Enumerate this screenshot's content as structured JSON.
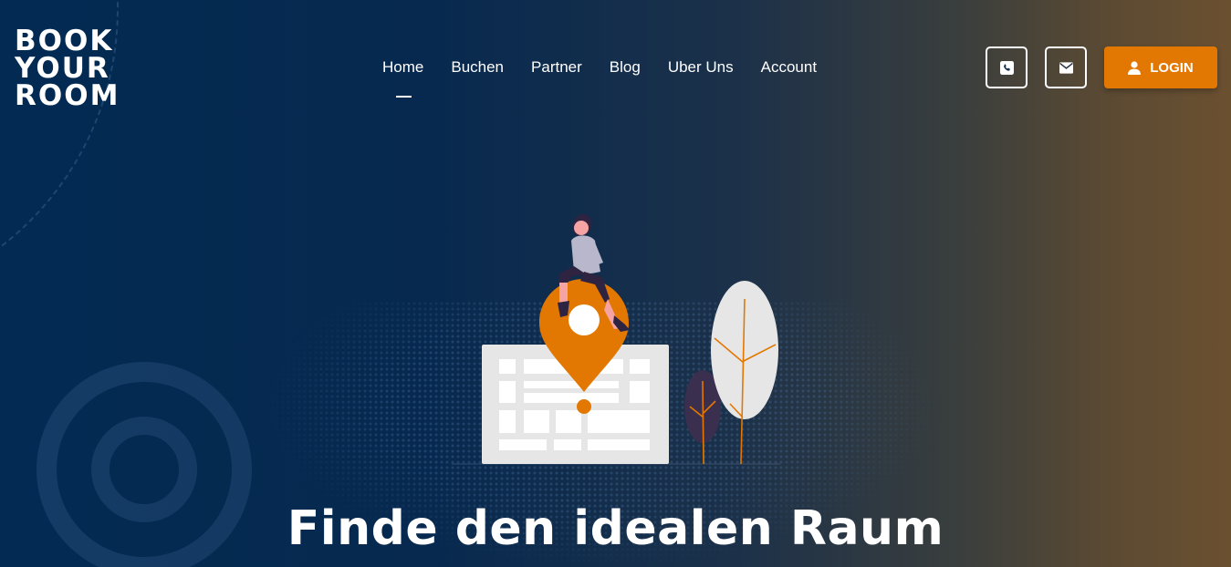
{
  "logo": {
    "line1": "BOOK",
    "line2": "YOUR",
    "line3": "ROOM"
  },
  "nav": {
    "items": [
      {
        "label": "Home",
        "active": true
      },
      {
        "label": "Buchen"
      },
      {
        "label": "Partner"
      },
      {
        "label": "Blog"
      },
      {
        "label": "Uber Uns"
      },
      {
        "label": "Account"
      }
    ]
  },
  "actions": {
    "phone_icon": "phone-icon",
    "mail_icon": "envelope-icon",
    "login_icon": "user-icon",
    "login_label": "LOGIN"
  },
  "hero": {
    "title": "Finde den idealen Raum"
  },
  "colors": {
    "accent": "#e27802",
    "background": "#022a52"
  }
}
